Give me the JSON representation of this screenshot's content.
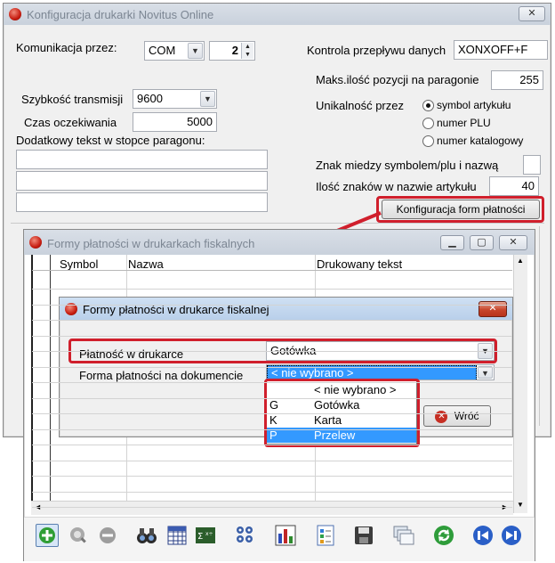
{
  "main_window": {
    "title": "Konfiguracja drukarki Novitus Online",
    "close_label": "✕",
    "komunikacja_label": "Komunikacja przez:",
    "komunikacja_value": "COM",
    "port_value": "2",
    "kontrola_label": "Kontrola przepływu danych",
    "kontrola_value": "XONXOFF+F",
    "maks_label": "Maks.ilość pozycji na paragonie",
    "maks_value": "255",
    "szybkosc_label": "Szybkość transmisji",
    "szybkosc_value": "9600",
    "czas_label": "Czas oczekiwania",
    "czas_value": "5000",
    "unikalnosc_label": "Unikalność przez",
    "radio_options": [
      "symbol artykułu",
      "numer PLU",
      "numer katalogowy"
    ],
    "selected_radio": 0,
    "dodatkowy_label": "Dodatkowy tekst w stopce paragonu:",
    "footer_lines": [
      "",
      "",
      ""
    ],
    "znak_label": "Znak miedzy symbolem/plu i nazwą",
    "znak_value": "",
    "ilosc_label": "Ilość znaków w nazwie artykułu",
    "ilosc_value": "40",
    "konfig_button": "Konfiguracja form płatności"
  },
  "payments_window": {
    "title": "Formy płatności w drukarkach fiskalnych",
    "min_label": "▁",
    "max_label": "▢",
    "close_label": "✕",
    "columns": [
      "Symbol",
      "Nazwa",
      "Drukowany tekst"
    ],
    "scroll_up": "▲",
    "scroll_down": "▼",
    "scroll_left": "◄",
    "scroll_right": "►"
  },
  "dialog": {
    "title": "Formy płatności w drukarce fiskalnej",
    "close_label": "✕",
    "platnosc_label": "Płatność w drukarce",
    "platnosc_value": "Gotówka",
    "forma_label": "Forma płatności na dokumencie",
    "forma_value": "< nie wybrano >",
    "wroc_label": "Wróć",
    "options": [
      {
        "code": "",
        "label": "< nie wybrano >"
      },
      {
        "code": "G",
        "label": "Gotówka"
      },
      {
        "code": "K",
        "label": "Karta"
      },
      {
        "code": "P",
        "label": "Przelew"
      }
    ],
    "selected_option": 3
  },
  "toolbar": {
    "icons": [
      "add-icon",
      "zoom-icon",
      "remove-icon",
      "binoculars-icon",
      "grid-icon",
      "formula-icon",
      "filter-icon",
      "chart-icon",
      "document-icon",
      "save-icon",
      "windows-icon",
      "refresh-icon",
      "prev-icon",
      "next-icon"
    ]
  },
  "colors": {
    "highlight_red": "#d01f2c",
    "selection_blue": "#3399ff",
    "title_active": "#b8cfea"
  }
}
